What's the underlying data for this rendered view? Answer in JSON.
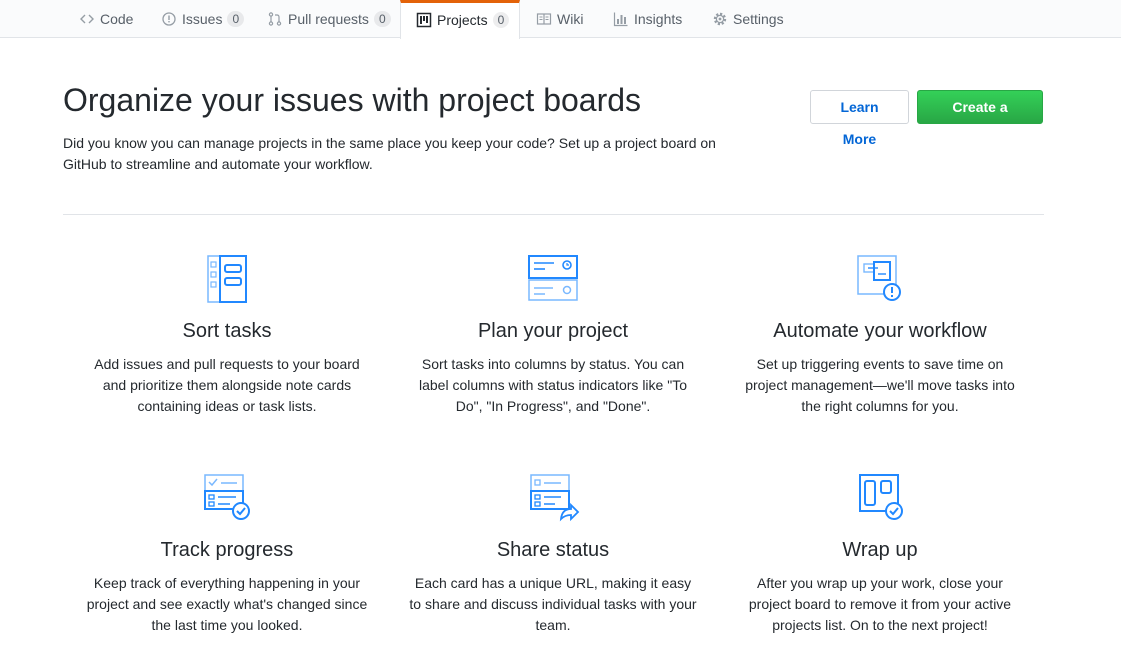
{
  "tabs": [
    {
      "label": "Code",
      "icon": "code-icon",
      "count": null,
      "selected": false
    },
    {
      "label": "Issues",
      "icon": "issue-icon",
      "count": "0",
      "selected": false
    },
    {
      "label": "Pull requests",
      "icon": "pull-request-icon",
      "count": "0",
      "selected": false
    },
    {
      "label": "Projects",
      "icon": "project-icon",
      "count": "0",
      "selected": true
    },
    {
      "label": "Wiki",
      "icon": "book-icon",
      "count": null,
      "selected": false
    },
    {
      "label": "Insights",
      "icon": "graph-icon",
      "count": null,
      "selected": false
    },
    {
      "label": "Settings",
      "icon": "gear-icon",
      "count": null,
      "selected": false
    }
  ],
  "hero": {
    "title": "Organize your issues with project boards",
    "description": "Did you know you can manage projects in the same place you keep your code? Set up a project board on GitHub to streamline and automate your workflow.",
    "learn_more_label": "Learn More",
    "create_label": "Create a project"
  },
  "features": [
    {
      "icon": "sort-tasks-icon",
      "title": "Sort tasks",
      "text": "Add issues and pull requests to your board and prioritize them alongside note cards containing ideas or task lists."
    },
    {
      "icon": "plan-project-icon",
      "title": "Plan your project",
      "text": "Sort tasks into columns by status. You can label columns with status indicators like \"To Do\", \"In Progress\", and \"Done\"."
    },
    {
      "icon": "automate-workflow-icon",
      "title": "Automate your workflow",
      "text": "Set up triggering events to save time on project management—we'll move tasks into the right columns for you."
    },
    {
      "icon": "track-progress-icon",
      "title": "Track progress",
      "text": "Keep track of everything happening in your project and see exactly what's changed since the last time you looked."
    },
    {
      "icon": "share-status-icon",
      "title": "Share status",
      "text": "Each card has a unique URL, making it easy to share and discuss individual tasks with your team."
    },
    {
      "icon": "wrap-up-icon",
      "title": "Wrap up",
      "text": "After you wrap up your work, close your project board to remove it from your active projects list. On to the next project!"
    }
  ],
  "colors": {
    "accent_tab": "#e36209",
    "link_blue": "#0366d6",
    "create_green": "#28a745",
    "icon_blue": "#2188ff"
  }
}
